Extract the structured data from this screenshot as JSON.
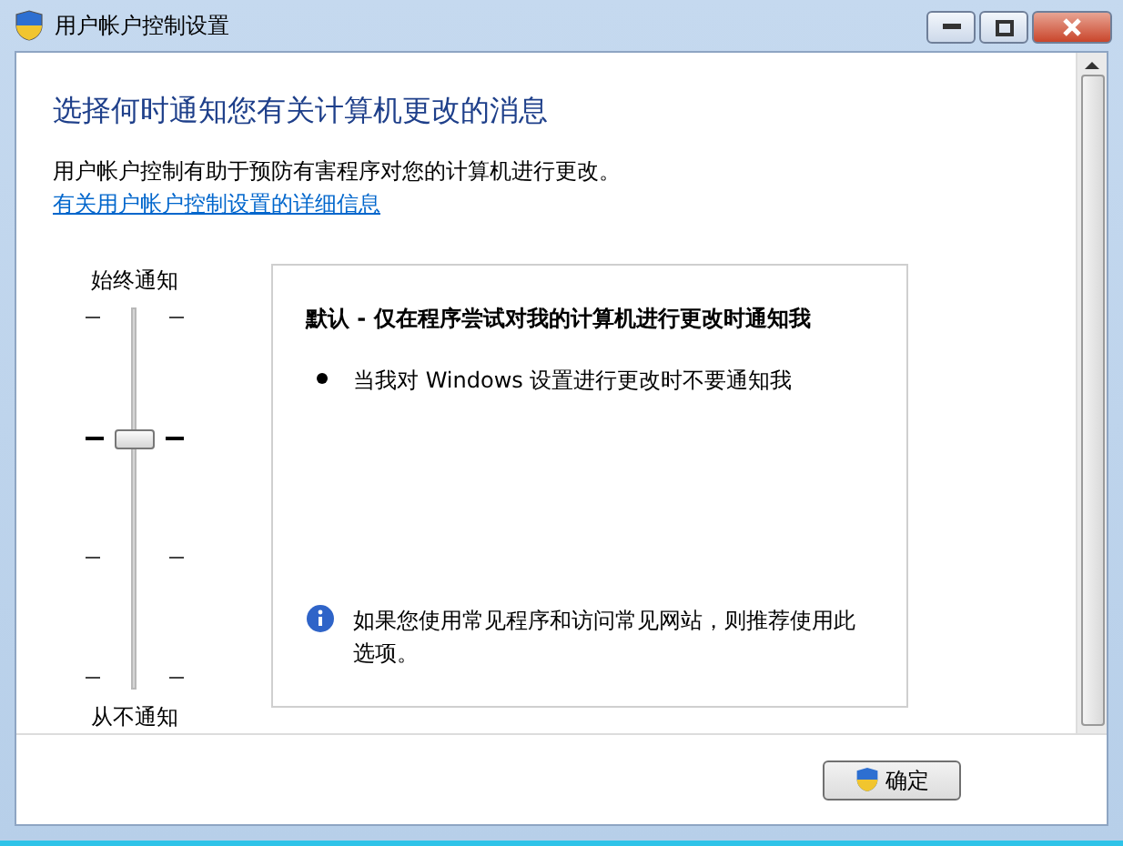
{
  "window": {
    "title": "用户帐户控制设置"
  },
  "heading": "选择何时通知您有关计算机更改的消息",
  "description": "用户帐户控制有助于预防有害程序对您的计算机进行更改。",
  "link": "有关用户帐户控制设置的详细信息",
  "slider": {
    "top_label": "始终通知",
    "bottom_label": "从不通知",
    "level": 0.667
  },
  "detail": {
    "title": "默认 - 仅在程序尝试对我的计算机进行更改时通知我",
    "bullets": [
      "当我对 Windows 设置进行更改时不要通知我"
    ],
    "note": "如果您使用常见程序和访问常见网站，则推荐使用此选项。"
  },
  "buttons": [
    {
      "label": "确定",
      "shield": true
    }
  ]
}
